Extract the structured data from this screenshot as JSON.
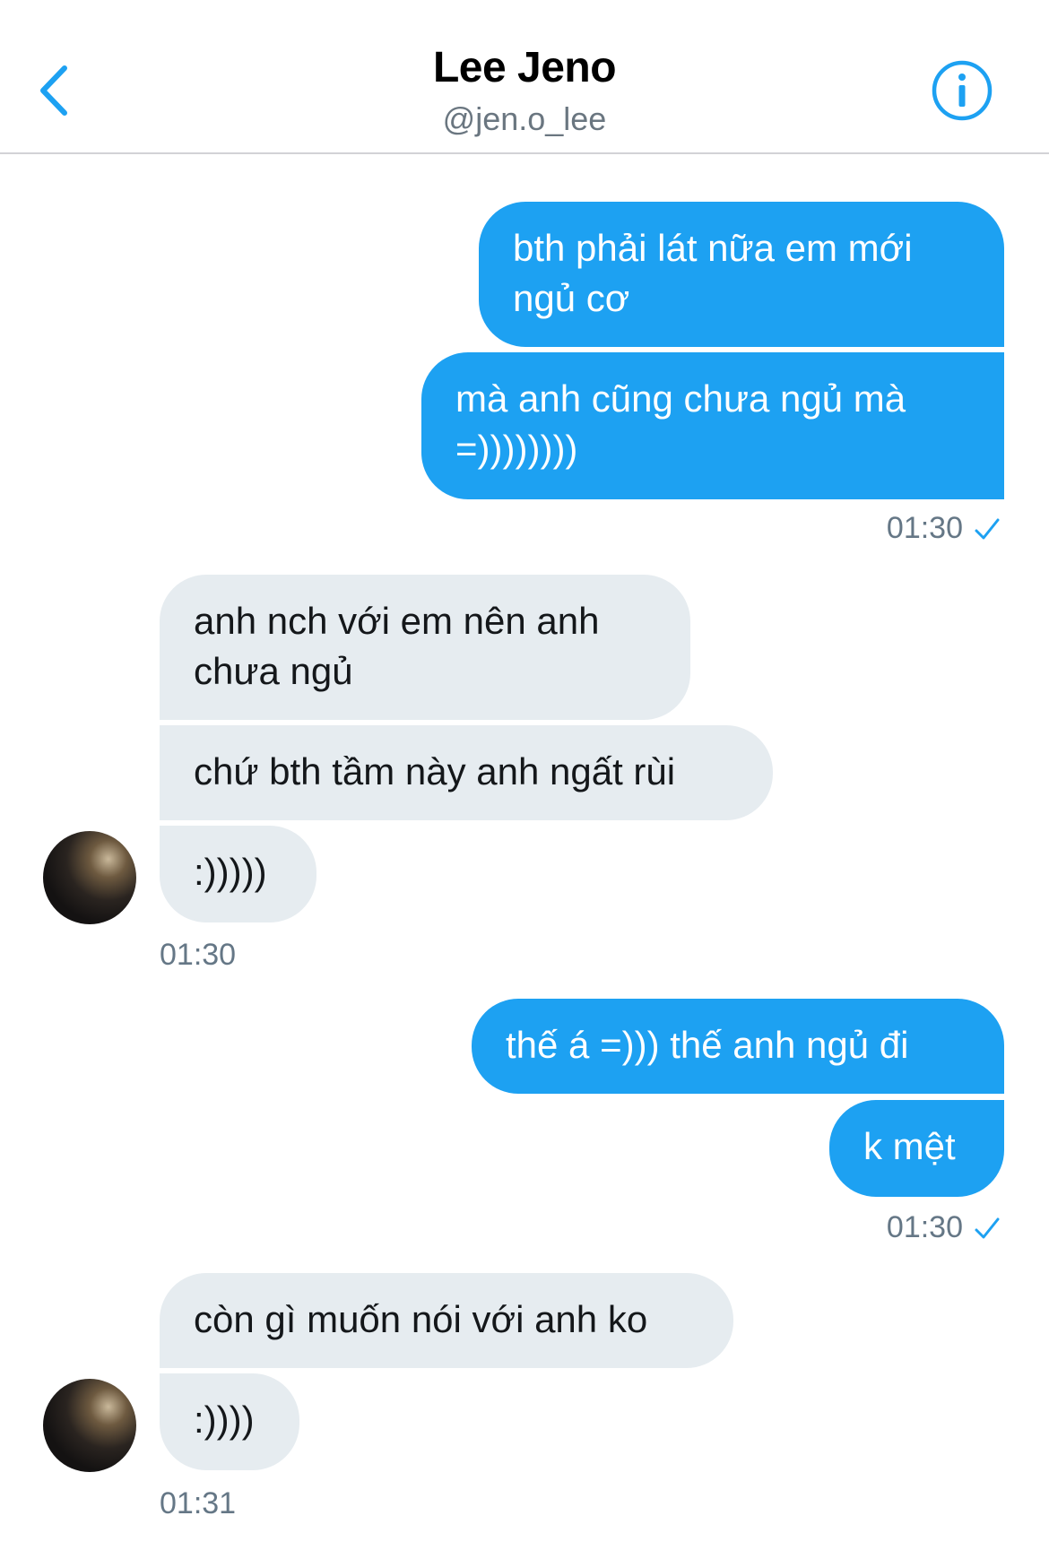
{
  "header": {
    "name": "Lee Jeno",
    "handle": "@jen.o_lee"
  },
  "messages": {
    "m1": "bth phải lát nữa em mới\nngủ cơ",
    "m2": "mà anh cũng chưa ngủ mà\n=))))))))",
    "t1": "01:30",
    "m3": "anh nch với em nên anh\nchưa ngủ",
    "m4": "chứ bth tầm này anh ngất rùi",
    "m5": ":)))))",
    "t2": "01:30",
    "m6": "thế á =))) thế anh ngủ đi",
    "m7": "k mệt",
    "t3": "01:30",
    "m8": "còn gì muốn nói với anh ko",
    "m9": ":))))",
    "t4": "01:31"
  },
  "colors": {
    "accent": "#1da1f2",
    "incoming_bubble": "#e6ecf0",
    "secondary_text": "#657786"
  },
  "icons": {
    "back": "chevron-left-icon",
    "info": "info-circle-icon",
    "read": "checkmark-icon"
  }
}
